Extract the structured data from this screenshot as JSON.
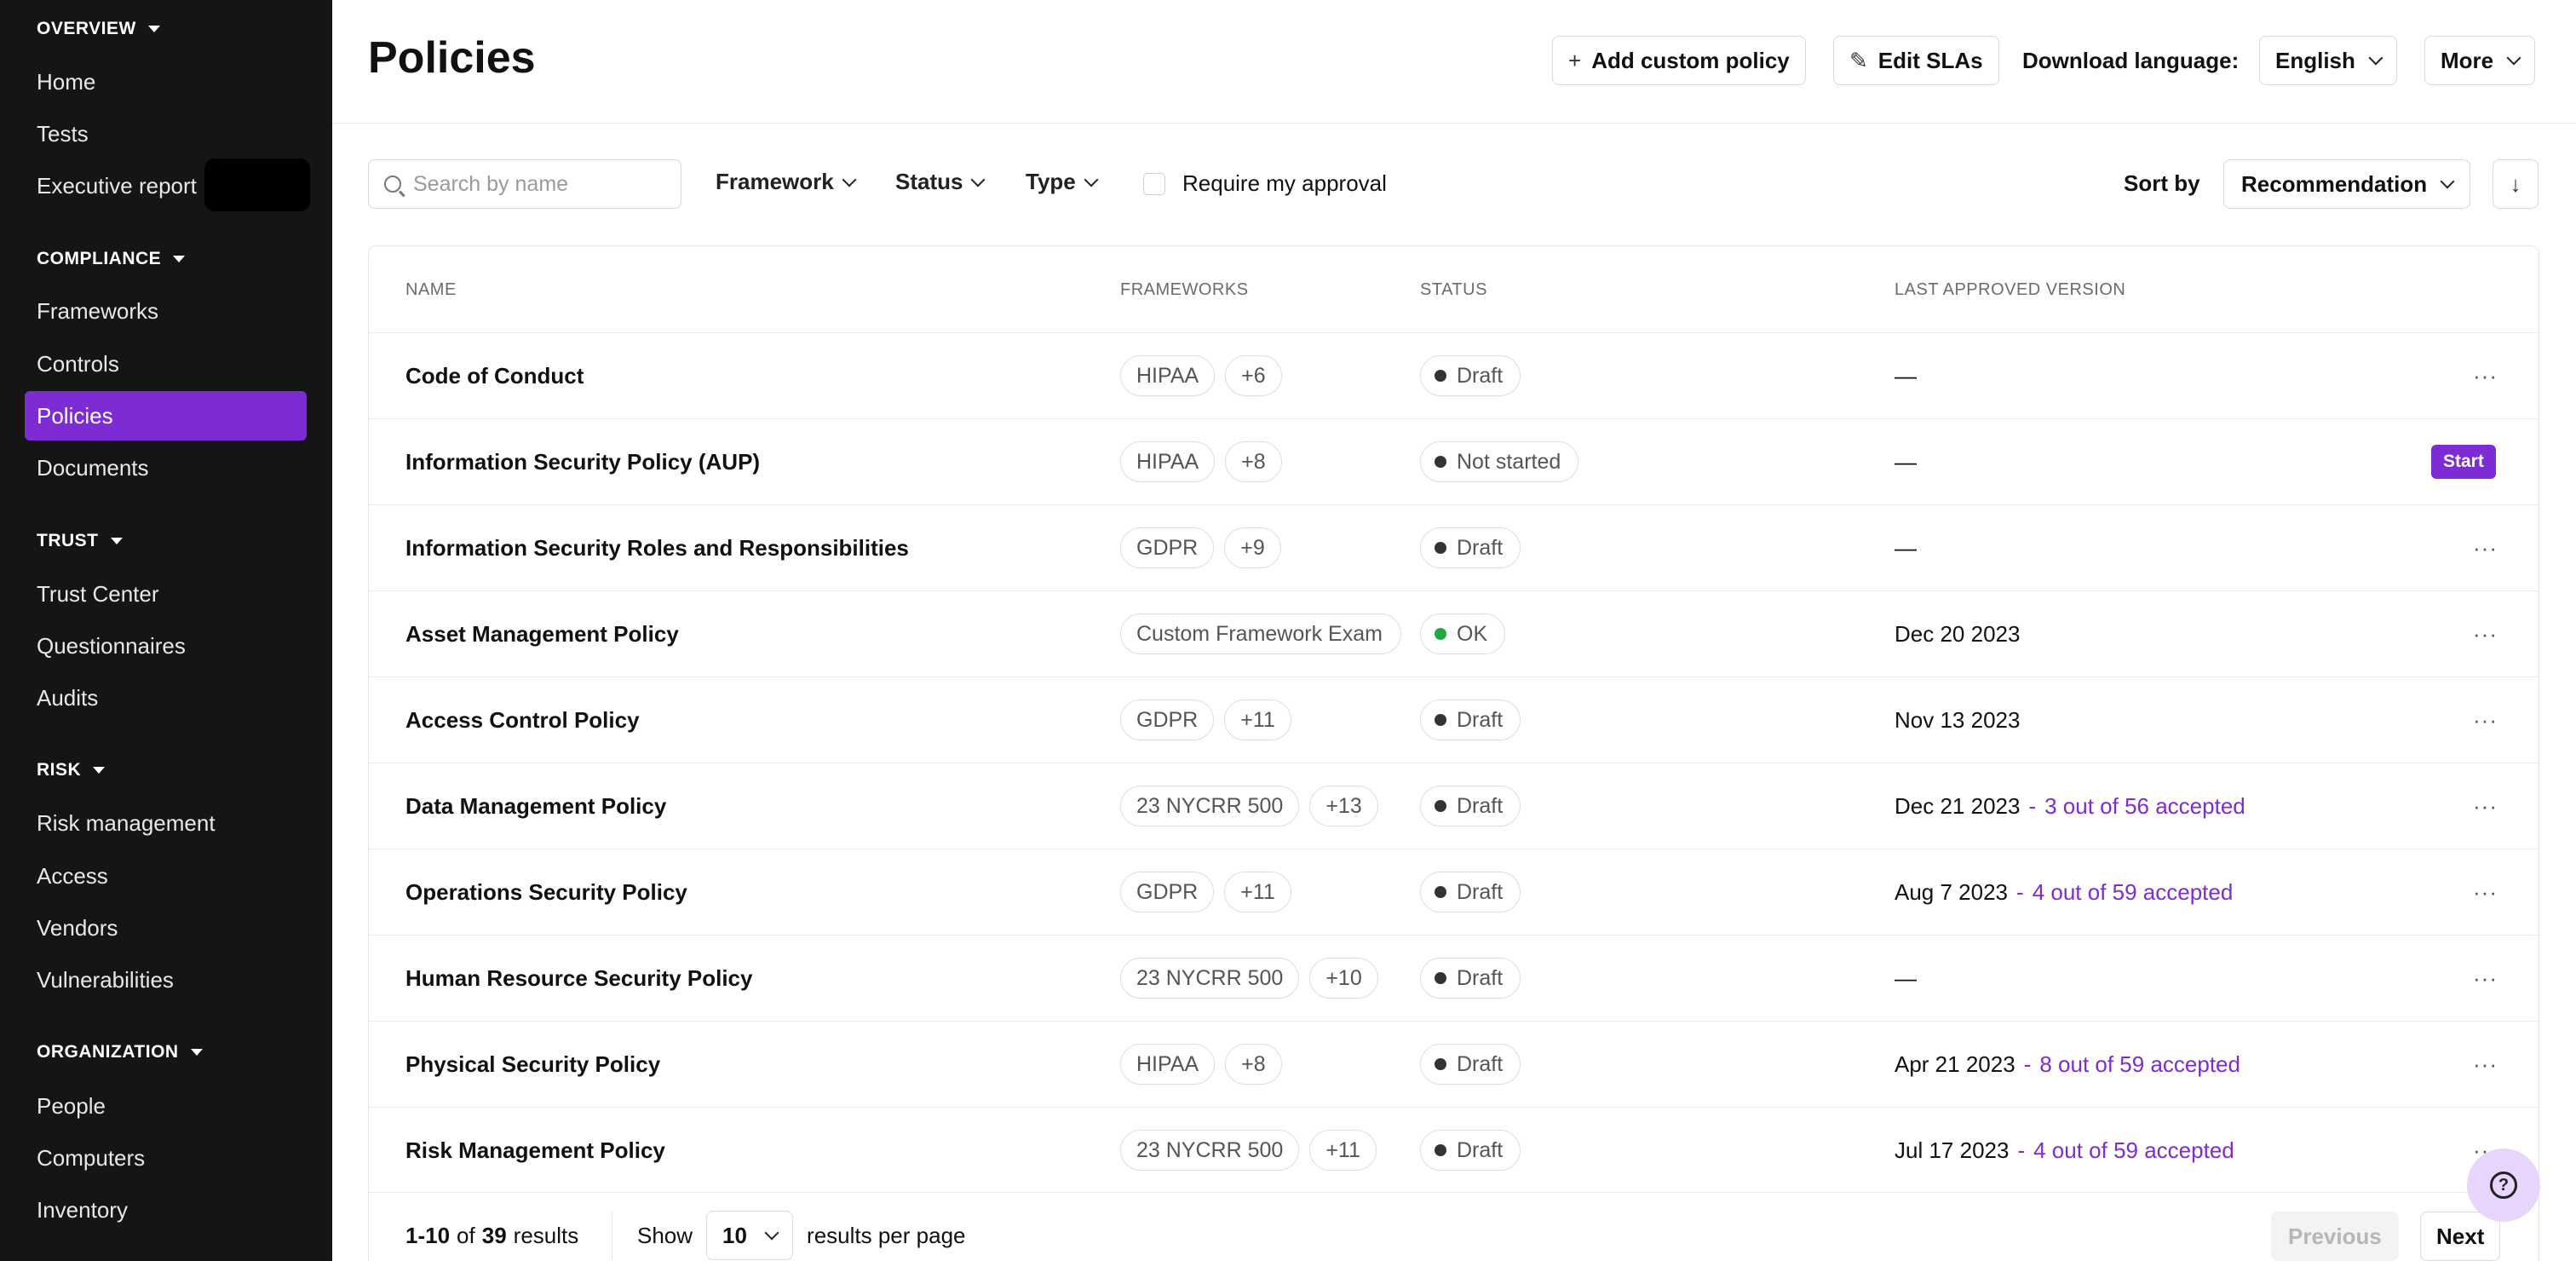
{
  "sidebar": {
    "sections": [
      {
        "title": "OVERVIEW",
        "items": [
          "Home",
          "Tests",
          "Executive report"
        ]
      },
      {
        "title": "COMPLIANCE",
        "items": [
          "Frameworks",
          "Controls",
          "Policies",
          "Documents"
        ]
      },
      {
        "title": "TRUST",
        "items": [
          "Trust Center",
          "Questionnaires",
          "Audits"
        ]
      },
      {
        "title": "RISK",
        "items": [
          "Risk management",
          "Access",
          "Vendors",
          "Vulnerabilities"
        ]
      },
      {
        "title": "ORGANIZATION",
        "items": [
          "People",
          "Computers",
          "Inventory"
        ]
      }
    ],
    "active_item": "Policies"
  },
  "header": {
    "title": "Policies",
    "add_policy_label": "Add custom policy",
    "edit_slas_label": "Edit SLAs",
    "download_language_label": "Download language:",
    "language_value": "English",
    "more_label": "More"
  },
  "filters": {
    "search_placeholder": "Search by name",
    "framework_label": "Framework",
    "status_label": "Status",
    "type_label": "Type",
    "require_approval_label": "Require my approval",
    "sort_by_label": "Sort by",
    "sort_value": "Recommendation",
    "sort_direction_glyph": "↓"
  },
  "table": {
    "columns": [
      "NAME",
      "FRAMEWORKS",
      "STATUS",
      "LAST APPROVED VERSION"
    ],
    "rows": [
      {
        "name": "Code of Conduct",
        "frameworks": [
          "HIPAA",
          "+6"
        ],
        "status": "Draft",
        "version": "—",
        "accepted": ""
      },
      {
        "name": "Information Security Policy (AUP)",
        "frameworks": [
          "HIPAA",
          "+8"
        ],
        "status": "Not started",
        "version": "—",
        "accepted": "",
        "action": "Start"
      },
      {
        "name": "Information Security Roles and Responsibilities",
        "frameworks": [
          "GDPR",
          "+9"
        ],
        "status": "Draft",
        "version": "—",
        "accepted": ""
      },
      {
        "name": "Asset Management Policy",
        "frameworks": [
          "Custom Framework Exam"
        ],
        "status": "OK",
        "version": "Dec 20 2023",
        "accepted": ""
      },
      {
        "name": "Access Control Policy",
        "frameworks": [
          "GDPR",
          "+11"
        ],
        "status": "Draft",
        "version": "Nov 13 2023",
        "accepted": ""
      },
      {
        "name": "Data Management Policy",
        "frameworks": [
          "23 NYCRR 500",
          "+13"
        ],
        "status": "Draft",
        "version": "Dec 21 2023",
        "accepted": "3 out of 56 accepted"
      },
      {
        "name": "Operations Security Policy",
        "frameworks": [
          "GDPR",
          "+11"
        ],
        "status": "Draft",
        "version": "Aug 7 2023",
        "accepted": "4 out of 59 accepted"
      },
      {
        "name": "Human Resource Security Policy",
        "frameworks": [
          "23 NYCRR 500",
          "+10"
        ],
        "status": "Draft",
        "version": "—",
        "accepted": ""
      },
      {
        "name": "Physical Security Policy",
        "frameworks": [
          "HIPAA",
          "+8"
        ],
        "status": "Draft",
        "version": "Apr 21 2023",
        "accepted": "8 out of 59 accepted"
      },
      {
        "name": "Risk Management Policy",
        "frameworks": [
          "23 NYCRR 500",
          "+11"
        ],
        "status": "Draft",
        "version": "Jul 17 2023",
        "accepted": "4 out of 59 accepted"
      }
    ],
    "more_glyph": "···"
  },
  "pagination": {
    "range": "1-10",
    "of_label": "of",
    "total": "39",
    "results_label": "results",
    "show_label": "Show",
    "per_page_value": "10",
    "per_page_label": "results per page",
    "previous_label": "Previous",
    "next_label": "Next"
  },
  "colors": {
    "accent": "#7d2bd4",
    "sidebar_bg": "#151515",
    "ok_dot": "#1fa844"
  }
}
